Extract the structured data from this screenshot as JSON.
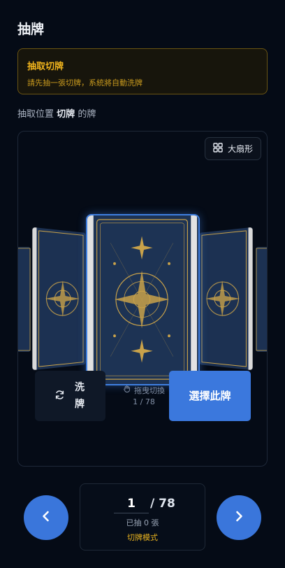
{
  "header": {
    "title": "抽牌"
  },
  "alert": {
    "title": "抽取切牌",
    "description": "請先抽一張切牌，系統將自動洗牌"
  },
  "position": {
    "prefix": "抽取位置",
    "name": "切牌",
    "suffix": "的牌"
  },
  "stage": {
    "fan_button_label": "大扇形",
    "drag_hint_label": "拖曳切換",
    "card_index": "1 / 78",
    "shuffle_button_label": "洗牌",
    "select_button_label": "選擇此牌"
  },
  "counter": {
    "current_value": "1",
    "total": "/ 78",
    "drawn_label": "已抽 0 張",
    "mode_label": "切牌模式"
  },
  "icons": {
    "fan": "grid-icon",
    "shuffle": "refresh-icon",
    "drag": "hand-icon",
    "prev": "chevron-left-icon",
    "next": "chevron-right-icon"
  },
  "colors": {
    "accent": "#3b78dd",
    "warning": "#f2b51d",
    "card_back": "#1c3152",
    "card_gold": "#c9a24a"
  }
}
